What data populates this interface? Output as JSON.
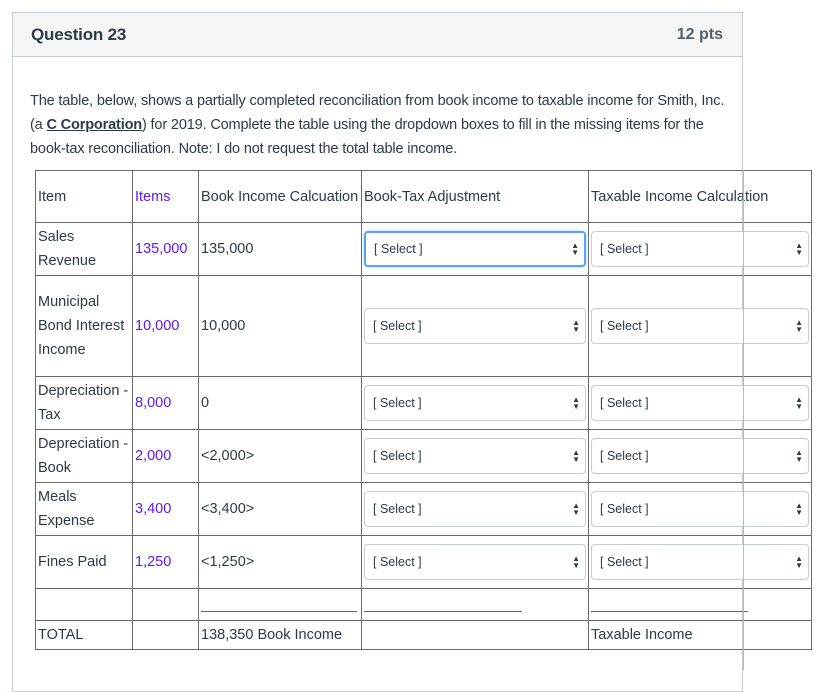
{
  "question": {
    "title": "Question 23",
    "points": "12 pts",
    "text_before_link": "The table, below, shows a partially completed reconciliation from book income to taxable income for Smith, Inc. (a ",
    "link_text": "C Corporation",
    "text_after_link": ") for 2019. Complete the table using the dropdown boxes to fill in the missing items for the book-tax reconciliation. Note: I do not request the total table income."
  },
  "table": {
    "headers": {
      "item": "Item",
      "items": "Items",
      "book_income": "Book Income Calcuation",
      "adjustment": "Book-Tax Adjustment",
      "taxable": "Taxable Income Calculation"
    },
    "rows": [
      {
        "item": "Sales Revenue",
        "amount": "135,000",
        "book": "135,000",
        "adj_select": "[ Select ]",
        "tax_select": "[ Select ]"
      },
      {
        "item": "Municipal Bond Interest Income",
        "amount": "10,000",
        "book": "10,000",
        "adj_select": "[ Select ]",
        "tax_select": "[ Select ]"
      },
      {
        "item": "Depreciation - Tax",
        "amount": "8,000",
        "book": "0",
        "adj_select": "[ Select ]",
        "tax_select": "[ Select ]"
      },
      {
        "item": "Depreciation - Book",
        "amount": "2,000",
        "book": "<2,000>",
        "adj_select": "[ Select ]",
        "tax_select": "[ Select ]"
      },
      {
        "item": "Meals Expense",
        "amount": "3,400",
        "book": "<3,400>",
        "adj_select": "[ Select ]",
        "tax_select": "[ Select ]"
      },
      {
        "item": "Fines Paid",
        "amount": "1,250",
        "book": "<1,250>",
        "adj_select": "[ Select ]",
        "tax_select": "[ Select ]"
      }
    ],
    "total": {
      "label": "TOTAL",
      "book": "138,350 Book Income",
      "taxable": "Taxable Income"
    }
  },
  "colors": {
    "accent_purple": "#5b1cf5",
    "focus_blue": "#5ba4f5"
  }
}
